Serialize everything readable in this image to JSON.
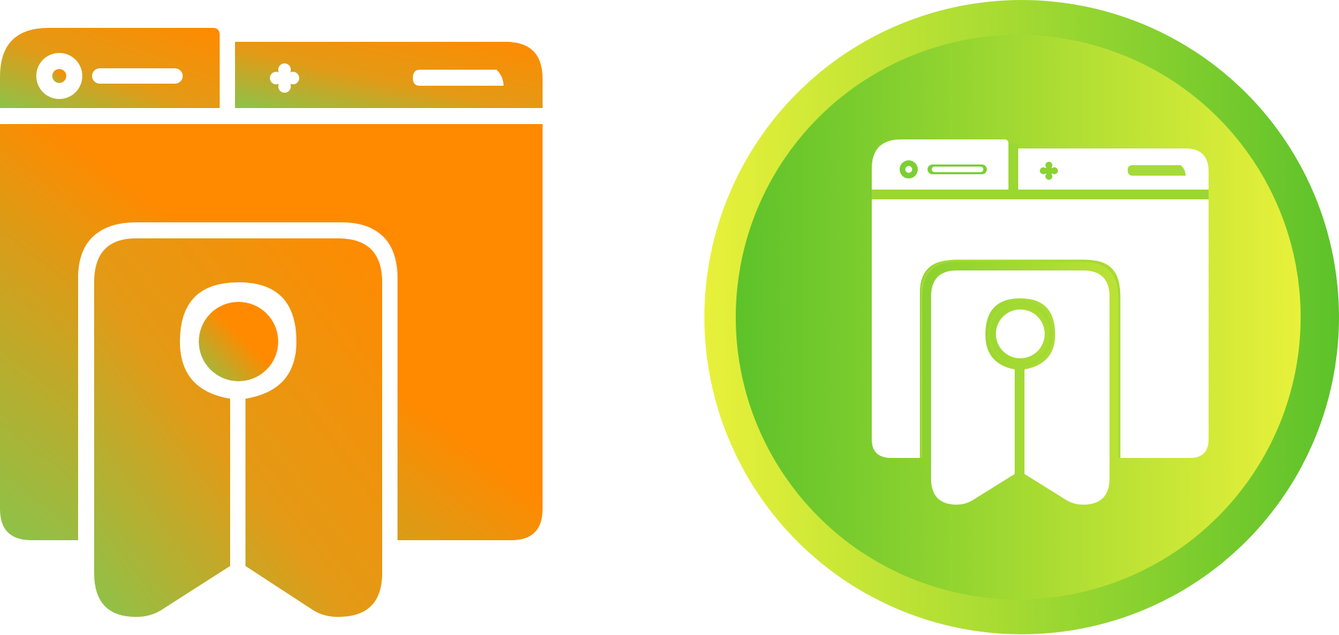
{
  "icons": [
    {
      "name": "browser-bookmark-icon",
      "style": "gradient",
      "colors": {
        "gradient_start": "#8BC34A",
        "gradient_end": "#FF8A00",
        "cutout": "#ffffff"
      }
    },
    {
      "name": "browser-bookmark-icon",
      "style": "circle-badge",
      "colors": {
        "outer_start": "#E8F13A",
        "outer_end": "#5DC22A",
        "inner_start": "#5DC22A",
        "inner_end": "#E8F13A",
        "glyph": "#ffffff"
      }
    }
  ]
}
